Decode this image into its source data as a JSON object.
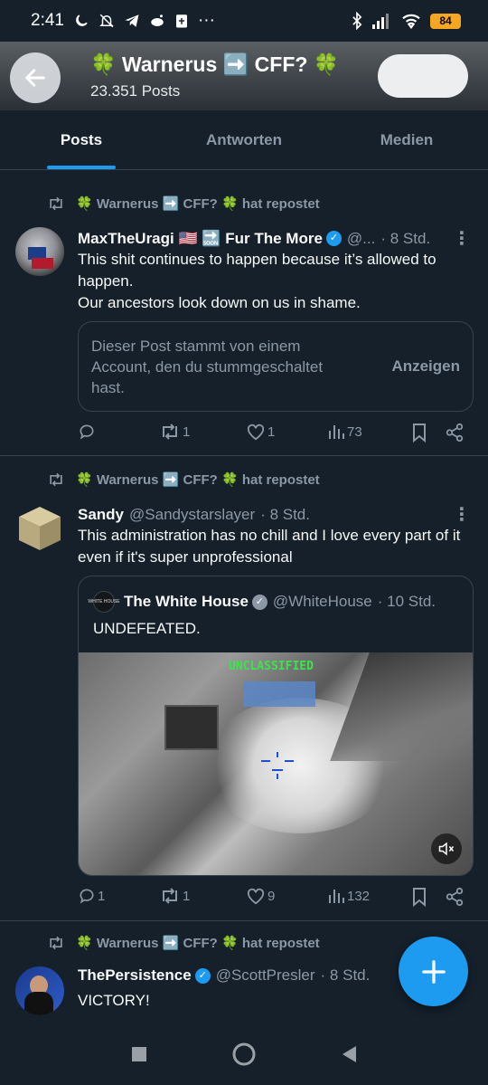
{
  "status": {
    "time": "2:41",
    "dots": "···",
    "battery": "84"
  },
  "header": {
    "title": "🍀 Warnerus ➡️ CFF? 🍀",
    "posts_count": "23.351 Posts"
  },
  "tabs": [
    {
      "label": "Posts",
      "active": true
    },
    {
      "label": "Antworten"
    },
    {
      "label": "Medien"
    }
  ],
  "posts": [
    {
      "repost_text": "🍀 Warnerus ➡️ CFF? 🍀 hat repostet",
      "name": "MaxTheUragi 🇺🇸 🔜 Fur The More",
      "handle": "@...",
      "time": "· 8 Std.",
      "text_lines": [
        "This shit continues to happen because it’s allowed to happen.",
        "Our ancestors look down on us in shame."
      ],
      "muted_notice": "Dieser Post stammt von einem Account, den du stummgeschaltet hast.",
      "muted_action": "Anzeigen",
      "replies": "",
      "reposts": "1",
      "likes": "1",
      "views": "73"
    },
    {
      "repost_text": "🍀 Warnerus ➡️ CFF? 🍀 hat repostet",
      "name": "Sandy",
      "handle": "@Sandystarslayer",
      "time": "· 8 Std.",
      "text": "This administration has no chill and I love every part of it even if it's super unprofessional",
      "quote": {
        "name": "The White House",
        "handle": "@WhiteHouse",
        "time": "· 10 Std.",
        "text": "UNDEFEATED.",
        "image_label": "UNCLASSIFIED",
        "avatar_text": "WHITE HOUSE"
      },
      "replies": "1",
      "reposts": "1",
      "likes": "9",
      "views": "132"
    },
    {
      "repost_text": "🍀 Warnerus ➡️ CFF? 🍀 hat repostet",
      "name": "ThePersistence",
      "handle": "@ScottPresler",
      "time": "· 8 Std.",
      "text": "VICTORY!"
    }
  ],
  "colors": {
    "accent": "#1d9bf0",
    "background": "#15202b",
    "muted": "#8b98a5",
    "border": "#38444d"
  }
}
